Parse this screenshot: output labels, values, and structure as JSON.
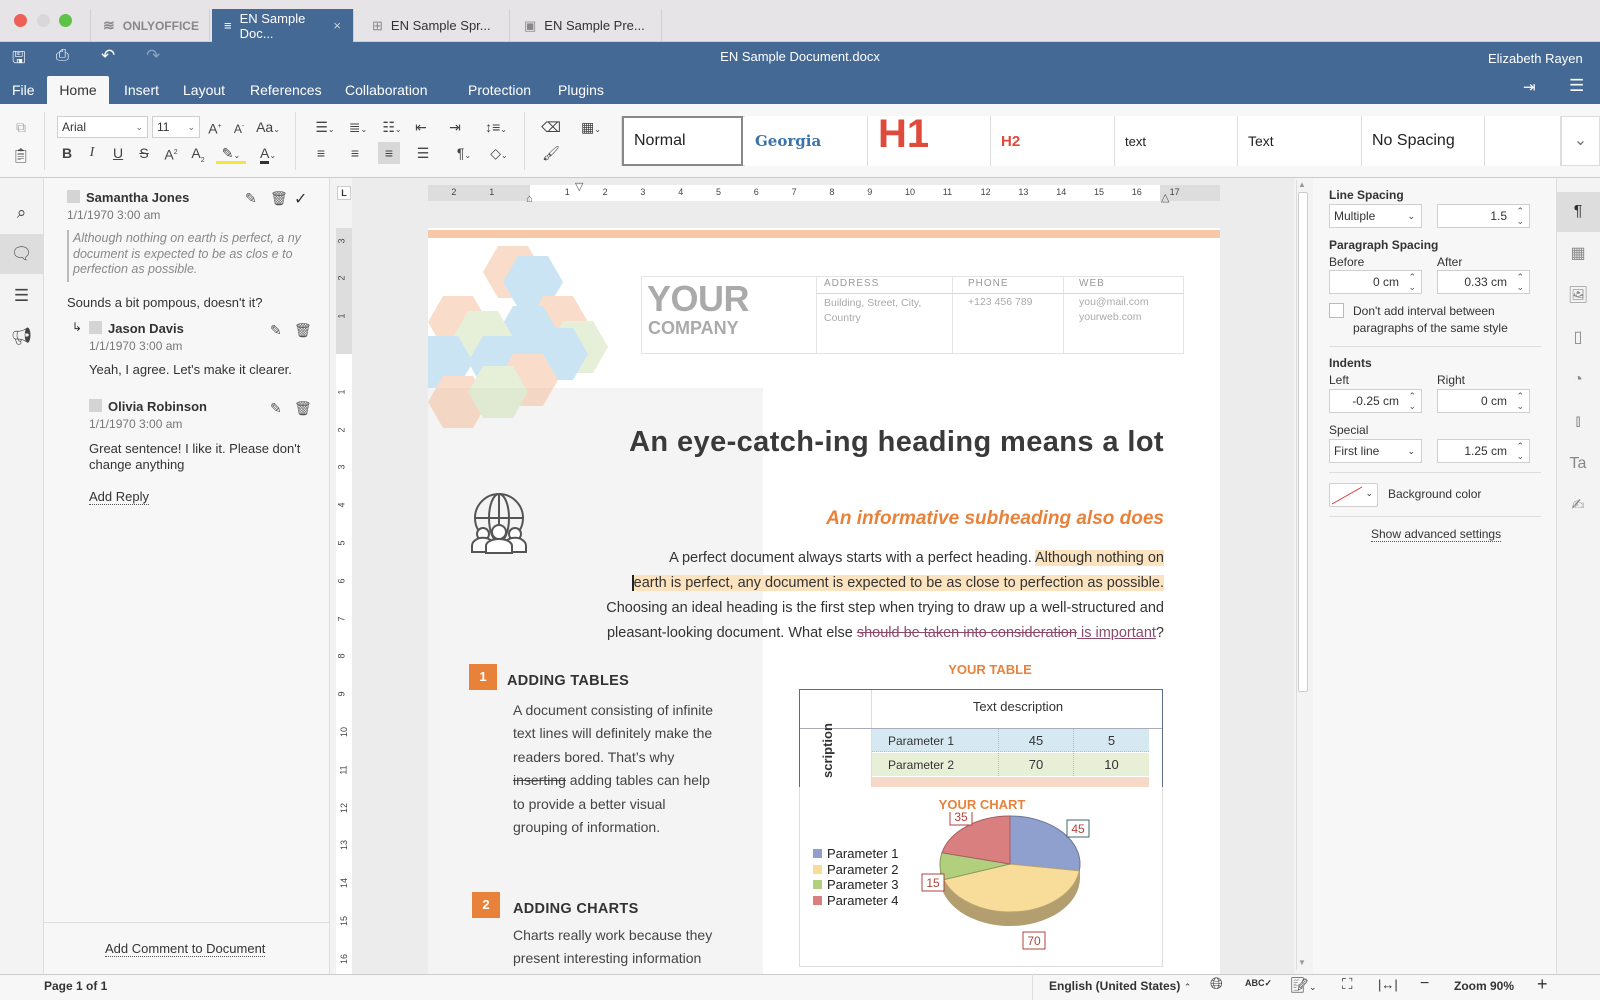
{
  "window": {
    "tabs": [
      {
        "label": "ONLYOFFICE",
        "icon": "onlyoffice-logo-icon"
      },
      {
        "label": "EN Sample Doc...",
        "icon": "document-icon",
        "active": true
      },
      {
        "label": "EN Sample Spr...",
        "icon": "spreadsheet-icon"
      },
      {
        "label": "EN Sample Pre...",
        "icon": "presentation-icon"
      }
    ],
    "close_glyph": "×"
  },
  "header": {
    "doc_title": "EN Sample Document.docx",
    "user_name": "Elizabeth Rayen",
    "menu": [
      "File",
      "Home",
      "Insert",
      "Layout",
      "References",
      "Collaboration",
      "Protection",
      "Plugins"
    ],
    "active_menu": "Home"
  },
  "toolbar": {
    "font_name": "Arial",
    "font_size": "11",
    "styles": [
      "Normal",
      "Georgia",
      "H1",
      "H2",
      "text",
      "Text",
      "No Spacing",
      ""
    ]
  },
  "comments": {
    "thread": {
      "author": "Samantha Jones",
      "date": "1/1/1970 3:00 am",
      "quote": "Although nothing on earth is perfect, a ny document is expected to be as clos e to perfection as possible.",
      "text": "Sounds a bit pompous, doesn't it?"
    },
    "replies": [
      {
        "author": "Jason Davis",
        "date": "1/1/1970 3:00 am",
        "text": "Yeah, I agree. Let's make it clearer."
      },
      {
        "author": "Olivia Robinson",
        "date": "1/1/1970 3:00 am",
        "text": "Great sentence! I like it. Please don't change anything"
      }
    ],
    "add_reply": "Add Reply",
    "add_comment": "Add Comment to Document"
  },
  "document": {
    "company_big": "YOUR",
    "company_small": "COMPANY",
    "address_label": "ADDRESS",
    "address_value": "Building, Street, City, Country",
    "phone_label": "PHONE",
    "phone_value": "+123 456 789",
    "web_label": "WEB",
    "web_value1": "you@mail.com",
    "web_value2": "yourweb.com",
    "heading": "An eye-catch-ing heading means a lot",
    "subheading": "An informative subheading also does",
    "para_part1": "A perfect document always starts with a perfect heading. ",
    "para_highlight1": "Although nothing on",
    "para_highlight2": "earth is perfect, any document is expected to be as close to perfection as possible.",
    "para_line3": "Choosing an ideal heading is the first step when trying to draw up a well-structured and",
    "para_line4_a": "pleasant-looking document. What else ",
    "para_line4_strike": "should be taken into consideration",
    "para_line4_b": " is important",
    "para_line4_c": "?",
    "section1_num": "1",
    "section1_title": "ADDING TABLES",
    "section1_lines": [
      "A document consisting of infinite",
      "text lines will definitely make the",
      "readers bored. That’s why"
    ],
    "section1_strike": "inserting",
    "section1_after_strike": " adding tables can help",
    "section1_more": [
      "to provide a better visual",
      "grouping of information."
    ],
    "section2_num": "2",
    "section2_title": "ADDING CHARTS",
    "section2_lines": [
      "Charts really work because they",
      "present interesting information"
    ],
    "table_title": "YOUR TABLE",
    "table_header": "Text description",
    "table_side": "scription",
    "table_rows": [
      {
        "label": "Parameter 1",
        "a": "45",
        "b": "5"
      },
      {
        "label": "Parameter 2",
        "a": "70",
        "b": "10"
      }
    ]
  },
  "chart_data": {
    "type": "pie",
    "title": "YOUR CHART",
    "categories": [
      "Parameter 1",
      "Parameter 2",
      "Parameter 3",
      "Parameter 4"
    ],
    "values": [
      45,
      70,
      15,
      35
    ],
    "colors": [
      "#8f9fce",
      "#f8dc9a",
      "#b2cf7e",
      "#d97f80"
    ],
    "legend": "left",
    "data_labels": true
  },
  "paragraph_settings": {
    "line_spacing_label": "Line Spacing",
    "line_spacing_type": "Multiple",
    "line_spacing_value": "1.5",
    "paragraph_spacing_label": "Paragraph Spacing",
    "before_label": "Before",
    "before_value": "0 cm",
    "after_label": "After",
    "after_value": "0.33 cm",
    "no_interval_label": "Don't add interval between paragraphs of the same style",
    "no_interval_checked": false,
    "indents_label": "Indents",
    "left_label": "Left",
    "left_value": "-0.25 cm",
    "right_label": "Right",
    "right_value": "0 cm",
    "special_label": "Special",
    "special_type": "First line",
    "special_value": "1.25 cm",
    "background_color_label": "Background color",
    "advanced_link": "Show advanced settings"
  },
  "statusbar": {
    "page": "Page 1 of 1",
    "language": "English (United States)",
    "zoom": "Zoom 90%"
  },
  "colors": {
    "brand": "#446995",
    "accent_orange": "#e8823b",
    "highlight": "#fbe3bf"
  }
}
